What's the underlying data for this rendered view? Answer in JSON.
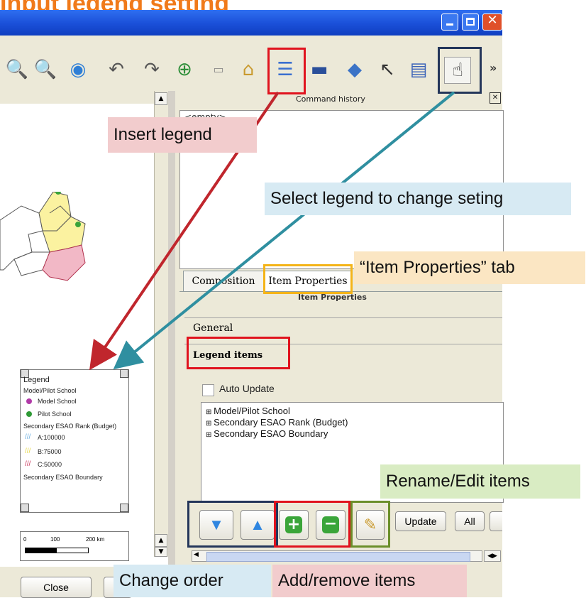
{
  "slide_title": "Input legend setting",
  "window": {
    "controls": [
      "minimize",
      "maximize",
      "close"
    ]
  },
  "toolbar": {
    "icons": [
      "zoom-out-icon",
      "zoom-in-icon",
      "refresh-icon",
      "undo-icon",
      "redo-icon",
      "add-map-icon",
      "add-image-icon",
      "add-label-icon",
      "insert-legend-icon",
      "add-scalebar-icon",
      "add-shape-icon",
      "add-arrow-icon",
      "add-table-icon",
      "select-move-icon"
    ],
    "overflow": "»"
  },
  "command_history": {
    "title": "Command history",
    "value": "<empty>"
  },
  "tabs": {
    "composition": "Composition",
    "item_properties": "Item Properties"
  },
  "item_properties_header": "Item Properties",
  "sections": {
    "general": "General",
    "legend_items": "Legend items"
  },
  "auto_update_label": "Auto Update",
  "tree_items": [
    "Model/Pilot School",
    "Secondary ESAO Rank (Budget)",
    "Secondary ESAO Boundary"
  ],
  "buttons": {
    "update": "Update",
    "all": "All",
    "close": "Close"
  },
  "map_legend": {
    "title": "Legend",
    "group1": "Model/Pilot School",
    "model": "Model School",
    "pilot": "Pilot School",
    "group2": "Secondary ESAO Rank (Budget)",
    "a": "A:100000",
    "b": "B:75000",
    "c": "C:50000",
    "group3": "Secondary ESAO Boundary"
  },
  "scalebar": {
    "t0": "0",
    "t1": "100",
    "t2": "200 km"
  },
  "callouts": {
    "insert_legend": "Insert legend",
    "select_legend": "Select legend to change seting",
    "item_properties_tab": "“Item Properties” tab",
    "rename_edit": "Rename/Edit items",
    "change_order": "Change order",
    "add_remove": "Add/remove items"
  },
  "colors": {
    "accent_red": "#e0131e",
    "navy": "#24365a",
    "green": "#6b8f2a",
    "orange": "#f4b418",
    "title_orange": "#f07a1a"
  }
}
